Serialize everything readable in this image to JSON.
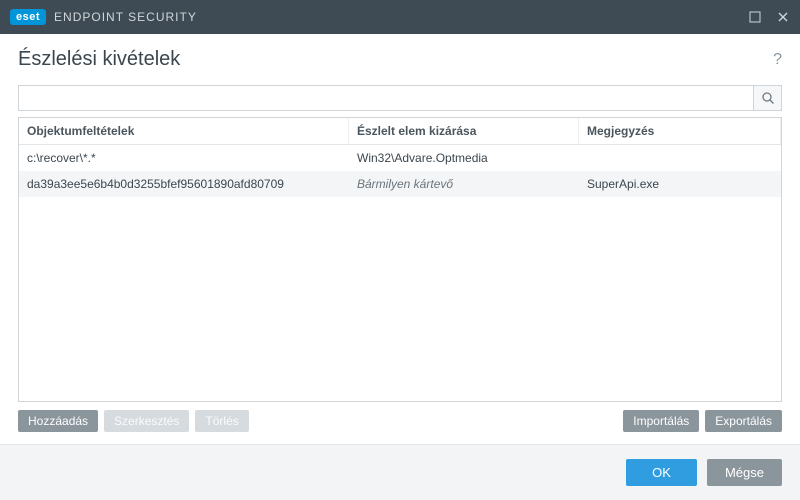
{
  "brand": {
    "badge": "eset",
    "product": "ENDPOINT SECURITY"
  },
  "header": {
    "title": "Észlelési kivételek",
    "help_symbol": "?"
  },
  "search": {
    "placeholder": ""
  },
  "table": {
    "columns": [
      "Objektumfeltételek",
      "Észlelt elem kizárása",
      "Megjegyzés"
    ],
    "rows": [
      {
        "object": "c:\\recover\\*.*",
        "detection": "Win32\\Advare.Optmedia",
        "comment": ""
      },
      {
        "object": "da39a3ee5e6b4b0d3255bfef95601890afd80709",
        "detection": "Bármilyen kártevő",
        "comment": "SuperApi.exe"
      }
    ]
  },
  "actions": {
    "add": "Hozzáadás",
    "edit": "Szerkesztés",
    "delete": "Törlés",
    "import": "Importálás",
    "export": "Exportálás"
  },
  "footer": {
    "ok": "OK",
    "cancel": "Mégse"
  }
}
